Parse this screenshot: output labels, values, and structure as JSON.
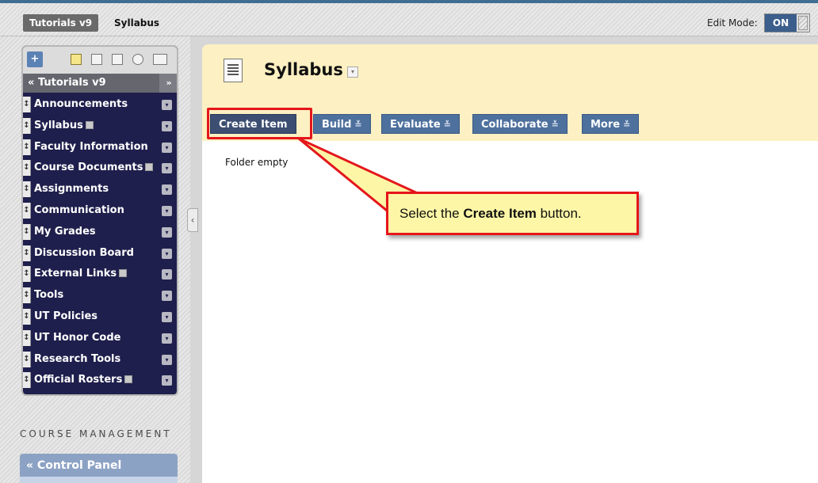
{
  "breadcrumb": {
    "course": "Tutorials v9",
    "page": "Syllabus"
  },
  "edit_mode": {
    "label": "Edit Mode:",
    "state": "ON"
  },
  "course_menu": {
    "toolbar_icons": [
      "add-icon",
      "list-view-icon",
      "folder-view-icon",
      "window-icon",
      "refresh-icon",
      "grid-icon"
    ],
    "title": "Tutorials v9",
    "header_prefix": "«",
    "collapse": "»",
    "items": [
      {
        "label": "Announcements",
        "mark": false
      },
      {
        "label": "Syllabus",
        "mark": true
      },
      {
        "label": "Faculty Information",
        "mark": false
      },
      {
        "label": "Course Documents",
        "mark": true
      },
      {
        "label": "Assignments",
        "mark": false
      },
      {
        "label": "Communication",
        "mark": false
      },
      {
        "label": "My Grades",
        "mark": false
      },
      {
        "label": "Discussion Board",
        "mark": false
      },
      {
        "label": "External Links",
        "mark": true
      },
      {
        "label": "Tools",
        "mark": false
      },
      {
        "label": "UT Policies",
        "mark": false
      },
      {
        "label": "UT Honor Code",
        "mark": false
      },
      {
        "label": "Research Tools",
        "mark": false
      },
      {
        "label": "Official Rosters",
        "mark": true
      }
    ]
  },
  "course_management": {
    "label": "COURSE MANAGEMENT",
    "control_panel": "Control Panel"
  },
  "content": {
    "title": "Syllabus",
    "buttons": [
      "Create Item",
      "Build",
      "Evaluate",
      "Collaborate",
      "More"
    ],
    "empty_text": "Folder empty"
  },
  "callout": {
    "pre": "Select the ",
    "bold": "Create Item",
    "post": " button."
  },
  "colors": {
    "menu_bg": "#1f1f4d",
    "header_bg": "#fdf0c2",
    "button_bg": "#4e709d",
    "highlight": "#e4161b",
    "callout_bg": "#fdf6a6"
  }
}
